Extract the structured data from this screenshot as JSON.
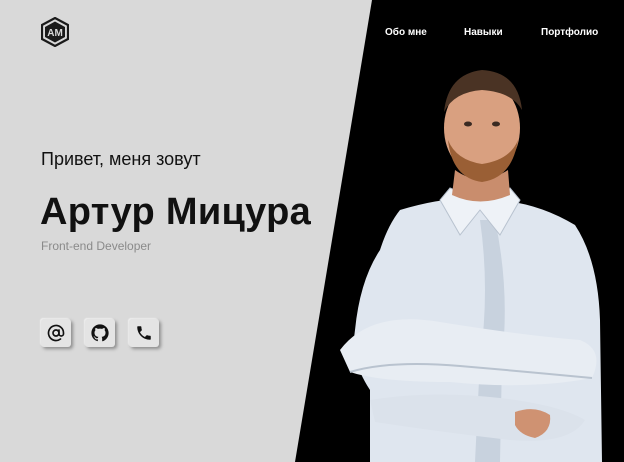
{
  "logo": {
    "icon": "am-monogram-hexagon-icon"
  },
  "nav": {
    "items": [
      {
        "label": "Обо мне"
      },
      {
        "label": "Навыки"
      },
      {
        "label": "Портфолио"
      }
    ]
  },
  "hero": {
    "greeting": "Привет, меня зовут",
    "name": "Артур Мицура",
    "role": "Front-end Developer"
  },
  "socials": [
    {
      "icon": "at-sign-icon",
      "label": "email"
    },
    {
      "icon": "github-icon",
      "label": "github"
    },
    {
      "icon": "phone-icon",
      "label": "phone"
    }
  ],
  "colors": {
    "background_light": "#d9d9d9",
    "background_dark": "#000000",
    "role_text": "#8a8a8a"
  }
}
